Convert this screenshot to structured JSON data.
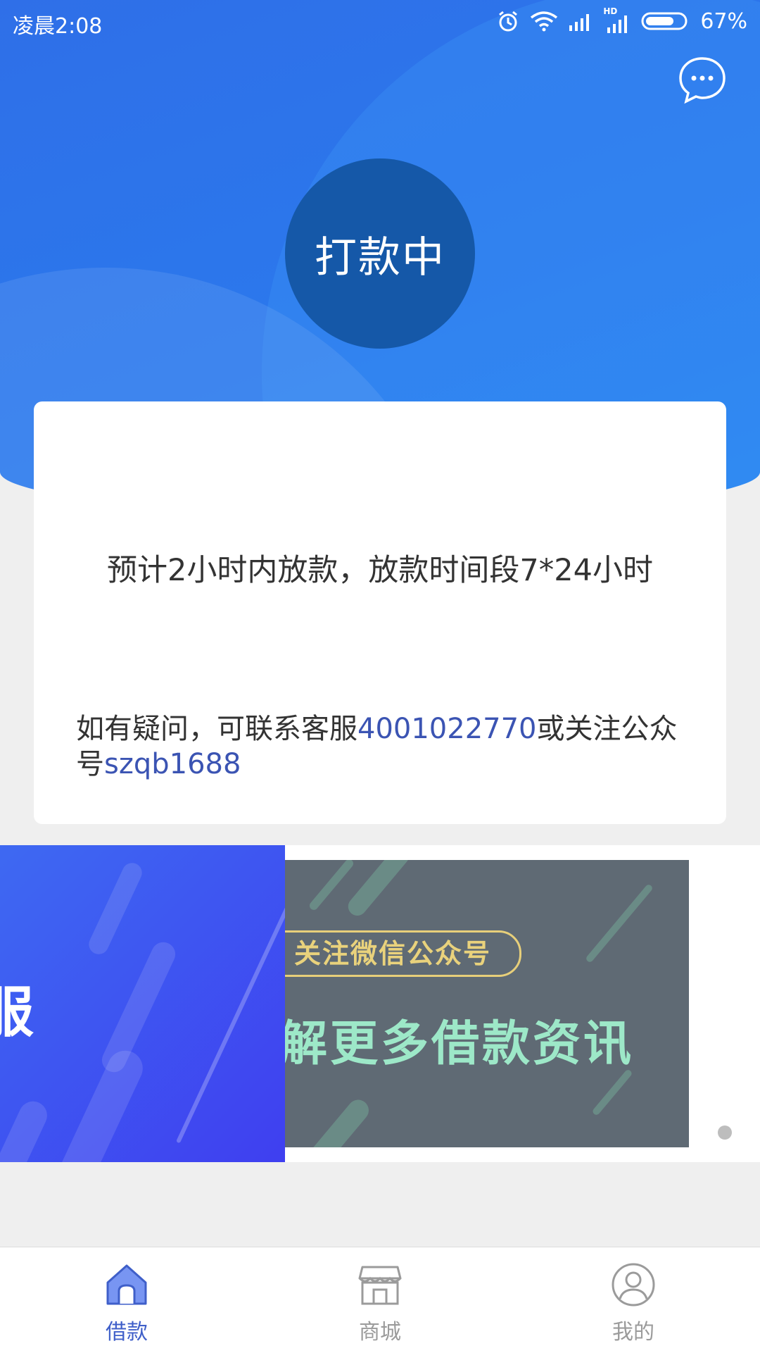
{
  "status_bar": {
    "time": "凌晨2:08",
    "battery": "67%",
    "hd_label": "HD"
  },
  "header": {
    "status_text": "打款中"
  },
  "card": {
    "main_text": "预计2小时内放款，放款时间段7*24小时",
    "note_prefix": "如有疑问，可联系客服",
    "phone": "4001022770",
    "note_middle": "或关注公众号",
    "wechat_id": "szqb1688"
  },
  "banner": {
    "left_slide_text": "服",
    "pill_text": "关注微信公众号",
    "headline": "解更多借款资讯"
  },
  "bottom_nav": {
    "items": [
      {
        "label": "借款",
        "icon": "home-icon",
        "active": true
      },
      {
        "label": "商城",
        "icon": "store-icon",
        "active": false
      },
      {
        "label": "我的",
        "icon": "user-icon",
        "active": false
      }
    ]
  },
  "colors": {
    "accent": "#3f5fc9",
    "hero_blue": "#2b78ec",
    "status_circle": "#1558a8",
    "link": "#3b54b3"
  }
}
